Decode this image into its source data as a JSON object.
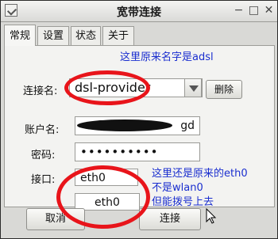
{
  "window": {
    "title": "宽带连接",
    "minimize": "−",
    "maximize": "□",
    "close": "✕"
  },
  "tabs": [
    {
      "label": "常规",
      "active": true
    },
    {
      "label": "设置",
      "active": false
    },
    {
      "label": "状态",
      "active": false
    },
    {
      "label": "关于",
      "active": false
    }
  ],
  "form": {
    "connection_label": "连接名:",
    "connection_value": "dsl-provider",
    "delete_label": "删除",
    "account_label": "账户名:",
    "account_value": "gd",
    "password_label": "密码:",
    "password_value": "••••••••••",
    "interface_label": "接口:",
    "interface_value": "eth0",
    "interface_dropdown_value": "eth0"
  },
  "buttons": {
    "cancel": "取消",
    "connect": "连接"
  },
  "annotations": {
    "note1": "这里原来名字是adsl",
    "note2_line1": "这里还是原来的eth0",
    "note2_line2": "不是wlan0",
    "note2_line3": "但能拨号上去"
  },
  "colors": {
    "annotation_ink": "#1a2ecf",
    "circle_marker": "#e8141a",
    "redaction": "#111111"
  }
}
